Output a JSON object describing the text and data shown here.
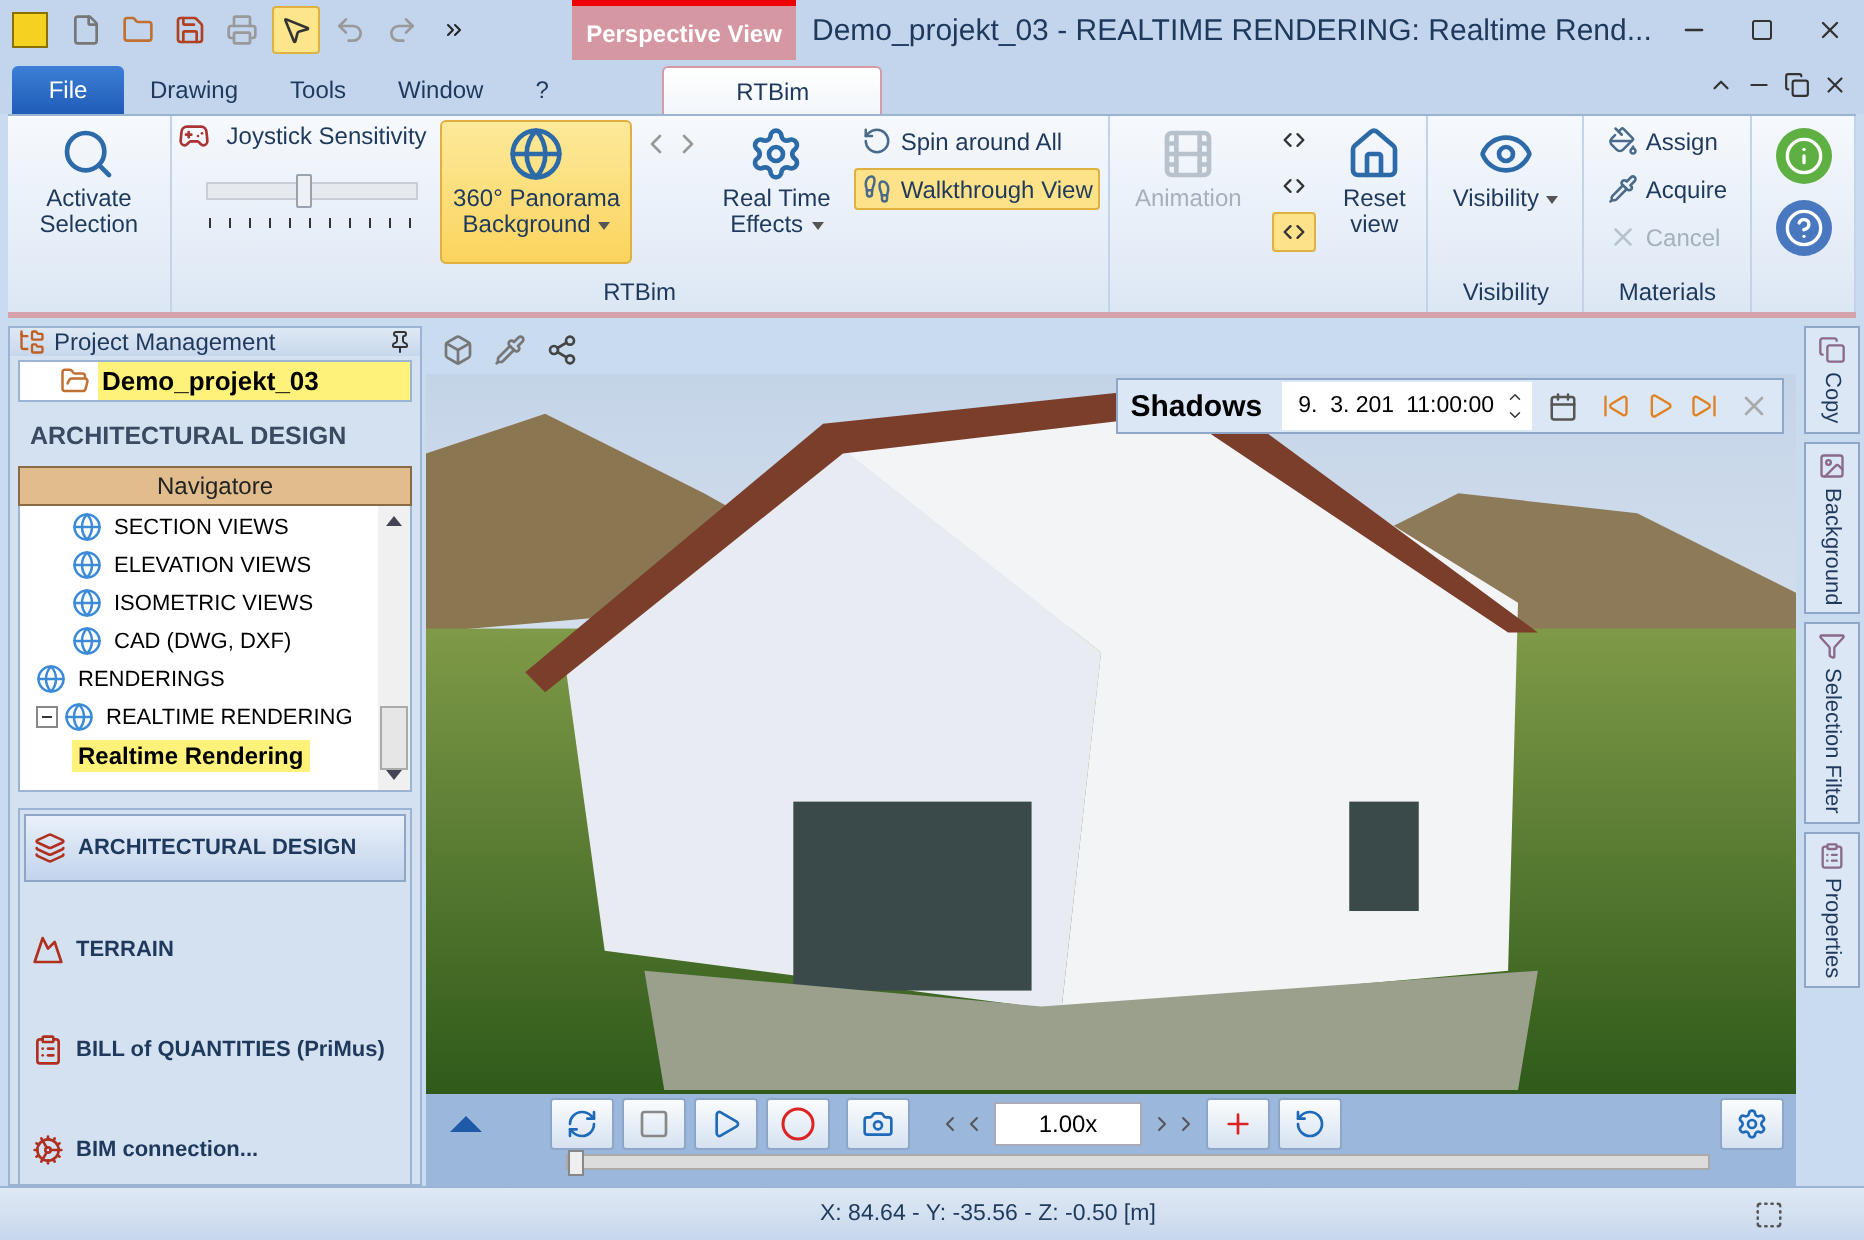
{
  "window": {
    "context_tab": "Perspective View",
    "title": "Demo_projekt_03 -  REALTIME RENDERING: Realtime Rend..."
  },
  "tabs": [
    {
      "label": "File",
      "kind": "file",
      "selected": false
    },
    {
      "label": "Drawing",
      "kind": "tab",
      "selected": false
    },
    {
      "label": "Tools",
      "kind": "tab",
      "selected": false
    },
    {
      "label": "Window",
      "kind": "tab",
      "selected": false
    },
    {
      "label": "?",
      "kind": "tab",
      "selected": false
    },
    {
      "label": "RTBim",
      "kind": "context",
      "selected": true
    }
  ],
  "ribbon": [
    {
      "items": [
        {
          "kind": "large",
          "label": "Activate Selection",
          "active": false,
          "disabled": false,
          "dropdown": false
        }
      ]
    },
    {
      "label": "RTBim",
      "items": [
        {
          "kind": "slider",
          "label": "Joystick Sensitivity",
          "level": 0.45
        },
        {
          "kind": "large",
          "label": "360° Panorama Background",
          "active": true,
          "disabled": false,
          "dropdown": true
        },
        {
          "kind": "nav"
        },
        {
          "kind": "large",
          "label": "Real Time Effects",
          "active": false,
          "disabled": false,
          "dropdown": true
        },
        {
          "kind": "column",
          "buttons": [
            {
              "label": "Spin around All",
              "active": false,
              "disabled": false
            },
            {
              "label": "Walkthrough View",
              "active": true,
              "disabled": false
            }
          ]
        }
      ]
    },
    {
      "items": [
        {
          "kind": "large",
          "label": "Animation",
          "active": false,
          "disabled": true,
          "dropdown": false
        },
        {
          "kind": "toggles",
          "buttons": [
            {
              "active": false
            },
            {
              "active": false
            },
            {
              "active": true
            }
          ]
        },
        {
          "kind": "large",
          "label": "Reset view",
          "active": false,
          "disabled": false,
          "dropdown": false
        }
      ]
    },
    {
      "label": "Visibility",
      "items": [
        {
          "kind": "large",
          "label": "Visibility",
          "active": false,
          "disabled": false,
          "dropdown": true
        }
      ]
    },
    {
      "label": "Materials",
      "items": [
        {
          "kind": "column",
          "buttons": [
            {
              "label": "Assign",
              "active": false,
              "disabled": false
            },
            {
              "label": "Acquire",
              "active": false,
              "disabled": false
            },
            {
              "label": "Cancel",
              "active": false,
              "disabled": true
            }
          ]
        }
      ]
    },
    {
      "items": [
        {
          "kind": "help"
        }
      ]
    }
  ],
  "project_panel": {
    "title": "Project Management",
    "project": "Demo_projekt_03",
    "section": "ARCHITECTURAL DESIGN",
    "navigator": "Navigatore",
    "tree": [
      {
        "children": [
          {
            "label": "SECTION VIEWS",
            "selected": false
          },
          {
            "label": "ELEVATION VIEWS",
            "selected": false
          },
          {
            "label": "ISOMETRIC VIEWS",
            "selected": false
          },
          {
            "label": "CAD (DWG, DXF)",
            "selected": false
          }
        ]
      },
      {
        "label": "RENDERINGS",
        "selected": false
      },
      {
        "label": "REALTIME RENDERING",
        "selected": false,
        "expanded": true,
        "children": [
          {
            "label": "Realtime Rendering",
            "selected": true
          }
        ]
      }
    ],
    "modules": [
      {
        "label": "ARCHITECTURAL DESIGN",
        "selected": true
      },
      {
        "label": "TERRAIN",
        "selected": false
      },
      {
        "label": "BILL of QUANTITIES (PriMus)",
        "selected": false
      },
      {
        "label": "BIM connection...",
        "selected": false
      }
    ]
  },
  "shadows": {
    "title": "Shadows",
    "date": "9.  3. 201",
    "time": "11:00:00"
  },
  "side_tabs": [
    "Copy",
    "Background",
    "Selection Filter",
    "Properties"
  ],
  "player": {
    "speed": "1.00x",
    "level": 0.0
  },
  "status_bar": {
    "coordinates": "X: 84.64 - Y: -35.56 - Z: -0.50 [m]"
  }
}
